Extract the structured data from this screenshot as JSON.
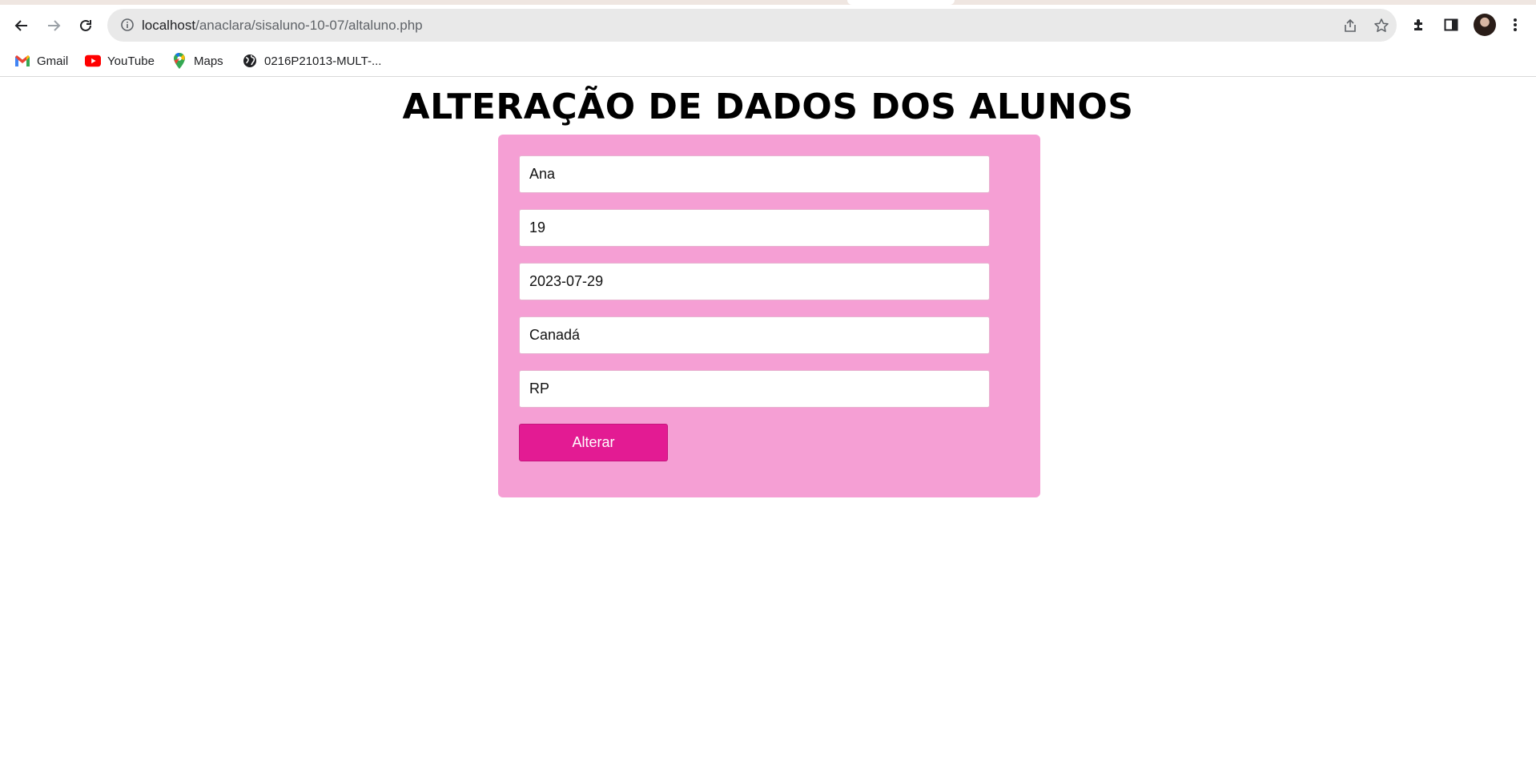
{
  "browser": {
    "url_host": "localhost",
    "url_path": "/anaclara/sisaluno-10-07/altaluno.php",
    "bookmarks": [
      {
        "label": "Gmail",
        "icon": "gmail-icon"
      },
      {
        "label": "YouTube",
        "icon": "youtube-icon"
      },
      {
        "label": "Maps",
        "icon": "maps-icon"
      },
      {
        "label": "0216P21013-MULT-...",
        "icon": "globe-icon"
      }
    ]
  },
  "page": {
    "title": "ALTERAÇÃO DE DADOS DOS ALUNOS",
    "fields": [
      {
        "value": "Ana"
      },
      {
        "value": "19"
      },
      {
        "value": "2023-07-29"
      },
      {
        "value": "Canadá"
      },
      {
        "value": "RP"
      }
    ],
    "submit_label": "Alterar"
  },
  "colors": {
    "card_bg": "#f59fd4",
    "button_bg": "#e31b93"
  }
}
